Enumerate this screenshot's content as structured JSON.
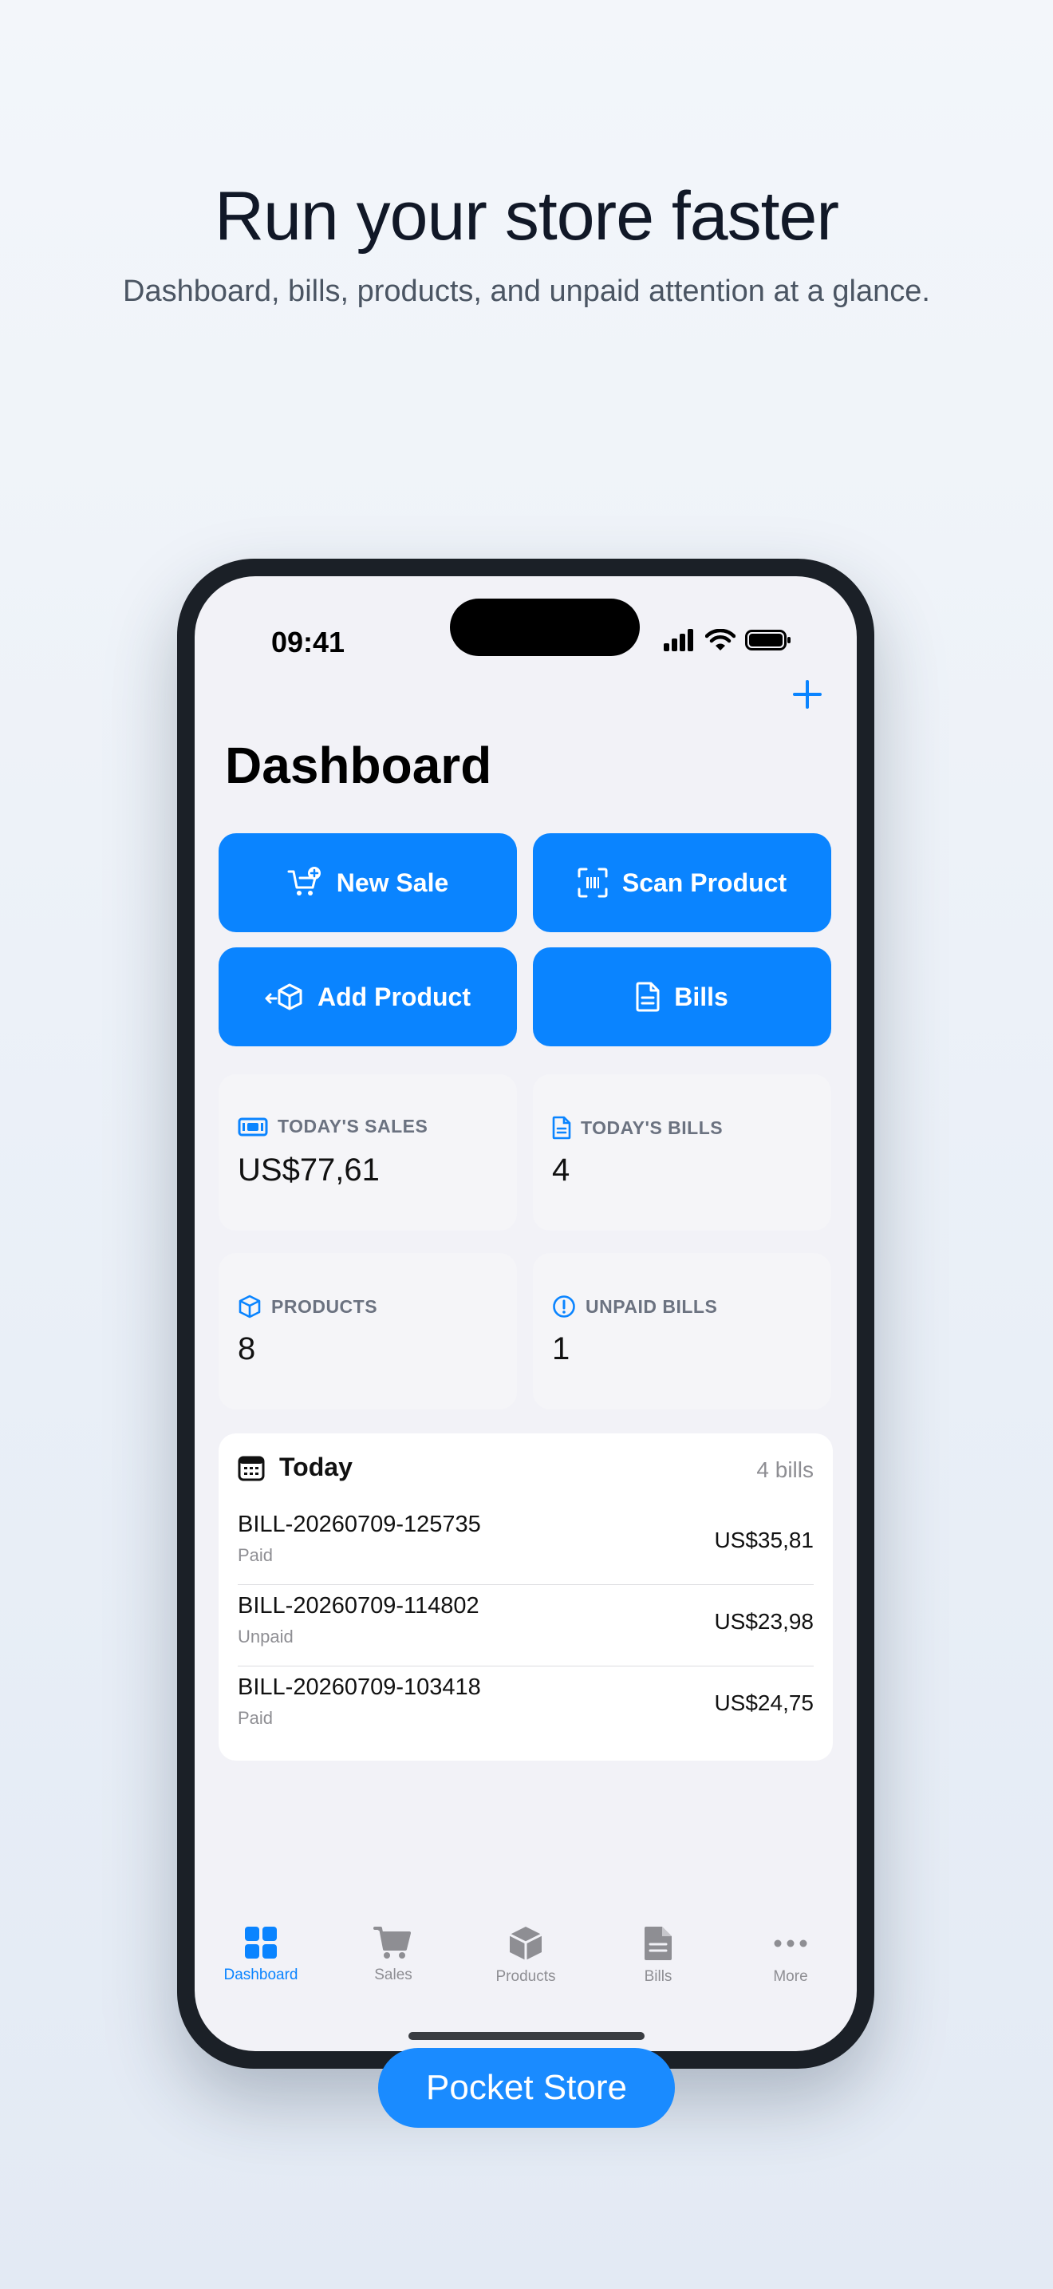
{
  "marketing": {
    "headline": "Run your store faster",
    "subheadline": "Dashboard, bills, products, and unpaid attention at a glance.",
    "brand": "Pocket Store"
  },
  "status_bar": {
    "time": "09:41"
  },
  "header": {
    "title": "Dashboard"
  },
  "actions": {
    "new_sale": "New Sale",
    "scan_product": "Scan Product",
    "add_product": "Add Product",
    "bills": "Bills"
  },
  "stats": {
    "todays_sales": {
      "label": "TODAY'S SALES",
      "value": "US$77,61"
    },
    "todays_bills": {
      "label": "TODAY'S BILLS",
      "value": "4"
    },
    "products": {
      "label": "PRODUCTS",
      "value": "8"
    },
    "unpaid_bills": {
      "label": "UNPAID BILLS",
      "value": "1"
    }
  },
  "today": {
    "title": "Today",
    "count": "4 bills",
    "bills": [
      {
        "id": "BILL-20260709-125735",
        "status": "Paid",
        "amount": "US$35,81"
      },
      {
        "id": "BILL-20260709-114802",
        "status": "Unpaid",
        "amount": "US$23,98"
      },
      {
        "id": "BILL-20260709-103418",
        "status": "Paid",
        "amount": "US$24,75"
      }
    ]
  },
  "tabs": {
    "dashboard": "Dashboard",
    "sales": "Sales",
    "products": "Products",
    "bills": "Bills",
    "more": "More"
  },
  "colors": {
    "accent": "#0a84ff",
    "screen_background": "#f2f2f7",
    "brand_pill": "#1a8bff"
  }
}
